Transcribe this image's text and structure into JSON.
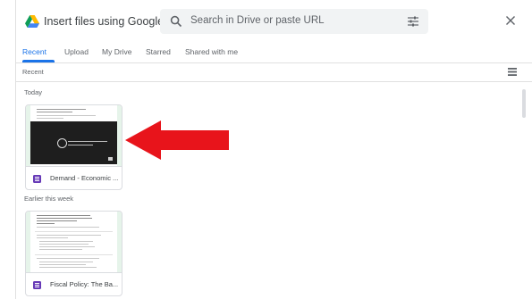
{
  "header": {
    "title": "Insert files using Google Drive",
    "search_placeholder": "Search in Drive or paste URL"
  },
  "tabs": [
    {
      "label": "Recent",
      "active": true
    },
    {
      "label": "Upload",
      "active": false
    },
    {
      "label": "My Drive",
      "active": false
    },
    {
      "label": "Starred",
      "active": false
    },
    {
      "label": "Shared with me",
      "active": false
    }
  ],
  "subheader": {
    "label": "Recent",
    "view_icon": "list-view-icon"
  },
  "sections": [
    {
      "title": "Today",
      "files": [
        {
          "name": "Demand - Economic ...",
          "type": "google-form"
        }
      ]
    },
    {
      "title": "Earlier this week",
      "files": [
        {
          "name": "Fiscal Policy: The Ba...",
          "type": "google-form"
        }
      ]
    }
  ],
  "colors": {
    "accent": "#1a73e8",
    "form_icon": "#673ab7",
    "arrow": "#e8141b",
    "thumb_bg": "#e6f4ea"
  },
  "icons": [
    "google-drive-logo",
    "search-icon",
    "search-options-icon",
    "close-icon",
    "list-view-icon",
    "form-file-icon",
    "red-arrow-annotation"
  ]
}
